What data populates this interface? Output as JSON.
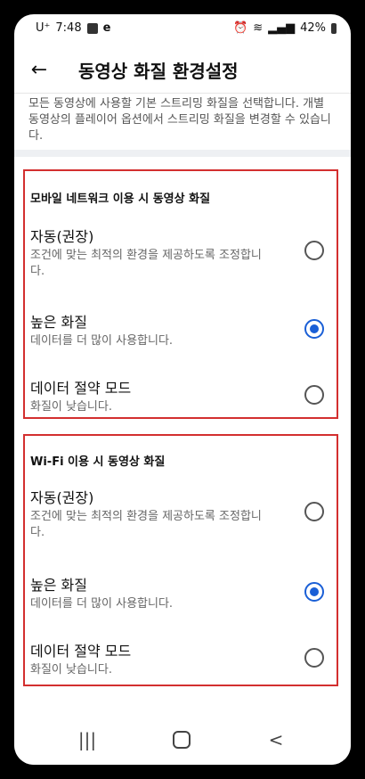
{
  "status_bar": {
    "carrier": "U⁺",
    "time": "7:48",
    "battery": "42%"
  },
  "header": {
    "title": "동영상 화질 환경설정"
  },
  "description": "모든 동영상에 사용할 기본 스트리밍 화질을 선택합니다. 개별 동영상의 플레이어 옵션에서 스트리밍 화질을 변경할 수 있습니다.",
  "sections": [
    {
      "title": "모바일 네트워크 이용 시 동영상 화질",
      "options": [
        {
          "label": "자동(권장)",
          "desc": "조건에 맞는 최적의 환경을 제공하도록 조정합니다.",
          "selected": false
        },
        {
          "label": "높은 화질",
          "desc": "데이터를 더 많이 사용합니다.",
          "selected": true
        },
        {
          "label": "데이터 절약 모드",
          "desc": "화질이 낮습니다.",
          "selected": false
        }
      ]
    },
    {
      "title": "Wi-Fi 이용 시 동영상 화질",
      "options": [
        {
          "label": "자동(권장)",
          "desc": "조건에 맞는 최적의 환경을 제공하도록 조정합니다.",
          "selected": false
        },
        {
          "label": "높은 화질",
          "desc": "데이터를 더 많이 사용합니다.",
          "selected": true
        },
        {
          "label": "데이터 절약 모드",
          "desc": "화질이 낮습니다.",
          "selected": false
        }
      ]
    }
  ],
  "colors": {
    "accent": "#1a5fd6",
    "highlight_box": "#d32f2f"
  }
}
